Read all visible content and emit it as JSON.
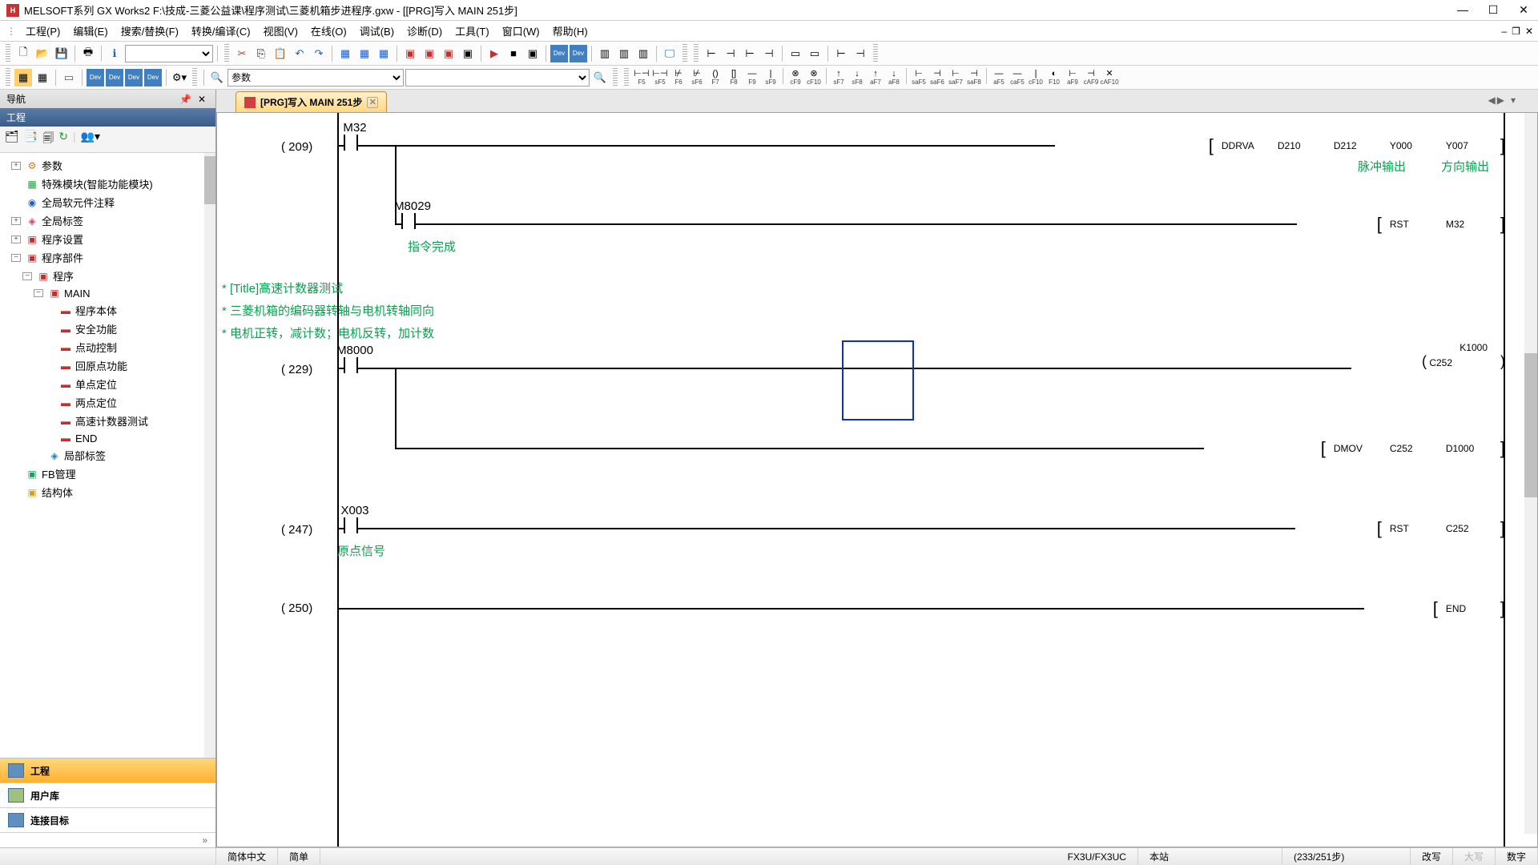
{
  "window": {
    "title": "MELSOFT系列 GX Works2 F:\\技成-三菱公益课\\程序测试\\三菱机箱步进程序.gxw - [[PRG]写入 MAIN 251步]"
  },
  "menus": [
    "工程(P)",
    "编辑(E)",
    "搜索/替换(F)",
    "转换/编译(C)",
    "视图(V)",
    "在线(O)",
    "调试(B)",
    "诊断(D)",
    "工具(T)",
    "窗口(W)",
    "帮助(H)"
  ],
  "toolbar2_combo": "参数",
  "fkeys": [
    "F5",
    "sF5",
    "F6",
    "sF6",
    "F7",
    "F8",
    "F9",
    "sF9",
    "cF9",
    "cF10",
    "sF7",
    "sF8",
    "aF7",
    "aF8",
    "saF5",
    "saF6",
    "saF7",
    "saF8",
    "aF5",
    "caF5",
    "cF10",
    "F10",
    "aF9",
    "cAF9",
    "cAF10"
  ],
  "nav": {
    "title": "导航",
    "section": "工程",
    "tree": {
      "params": "参数",
      "special": "特殊模块(智能功能模块)",
      "global_comment": "全局软元件注释",
      "global_label": "全局标签",
      "prog_setting": "程序设置",
      "prog_parts": "程序部件",
      "program": "程序",
      "main": "MAIN",
      "items": [
        "程序本体",
        "安全功能",
        "点动控制",
        "回原点功能",
        "单点定位",
        "两点定位",
        "高速计数器测试",
        "END"
      ],
      "local_label": "局部标签",
      "fb": "FB管理",
      "struct": "结构体"
    },
    "tabs": {
      "project": "工程",
      "userlib": "用户库",
      "conn": "连接目标"
    }
  },
  "doc_tab": "[PRG]写入 MAIN 251步",
  "ladder": {
    "r1": {
      "step": "(   209)",
      "contact": "M32",
      "out": [
        "DDRVA",
        "D210",
        "D212",
        "Y000",
        "Y007"
      ],
      "note1": "脉冲输出",
      "note2": "方向输出"
    },
    "r1b": {
      "contact": "M8029",
      "note": "指令完成",
      "out": [
        "RST",
        "M32"
      ]
    },
    "comments": [
      "* [Title]高速计数器测试",
      "* 三菱机箱的编码器转轴与电机转轴同向",
      "* 电机正转，减计数；电机反转，加计数"
    ],
    "r2": {
      "step": "(   229)",
      "contact": "M8000",
      "counter_k": "K1000",
      "counter_c": "C252"
    },
    "r2b": {
      "out": [
        "DMOV",
        "C252",
        "D1000"
      ]
    },
    "r3": {
      "step": "(   247)",
      "contact": "X003",
      "note": "原点信号",
      "out": [
        "RST",
        "C252"
      ]
    },
    "r4": {
      "step": "(   250)",
      "out": [
        "END"
      ]
    }
  },
  "status": {
    "lang": "简体中文",
    "mode": "简单",
    "plc": "FX3U/FX3UC",
    "station": "本站",
    "steps": "(233/251步)",
    "overwrite": "改写",
    "caps": "大写",
    "num": "数字"
  }
}
